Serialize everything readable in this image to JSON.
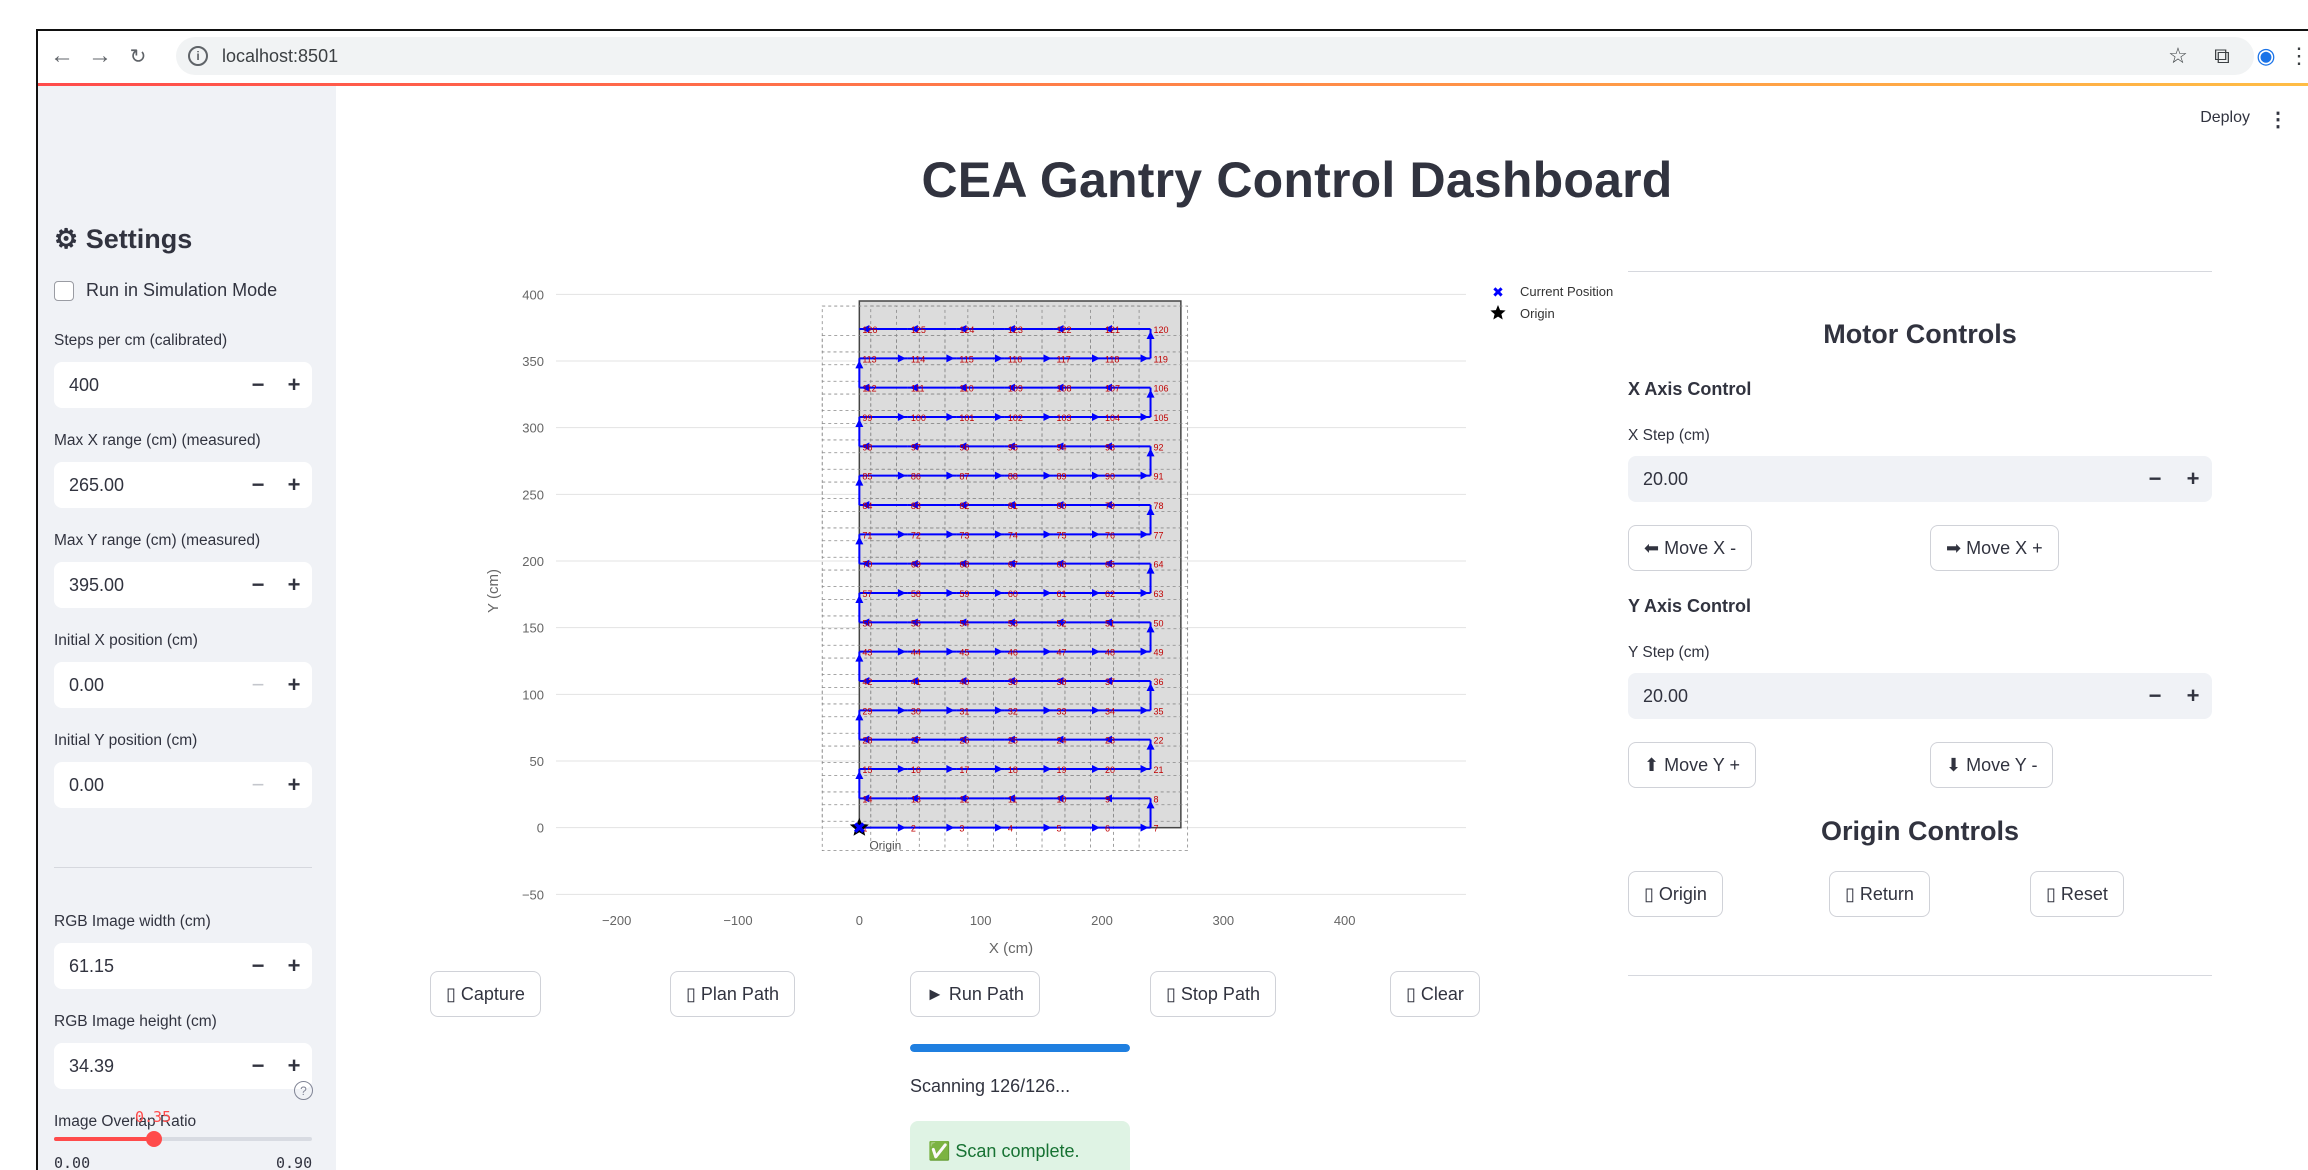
{
  "browser": {
    "url": "localhost:8501",
    "back_icon": "arrow-back-icon",
    "forward_icon": "arrow-forward-icon",
    "reload_icon": "reload-icon"
  },
  "header": {
    "deploy_label": "Deploy"
  },
  "sidebar": {
    "title": "⚙ Settings",
    "simulation_label": "Run in Simulation Mode",
    "simulation_checked": false,
    "fields": [
      {
        "label": "Steps per cm (calibrated)",
        "value": "400"
      },
      {
        "label": "Max X range (cm) (measured)",
        "value": "265.00"
      },
      {
        "label": "Max Y range (cm) (measured)",
        "value": "395.00"
      },
      {
        "label": "Initial X position (cm)",
        "value": "0.00"
      },
      {
        "label": "Initial Y position (cm)",
        "value": "0.00"
      },
      {
        "label": "RGB Image width (cm)",
        "value": "61.15"
      },
      {
        "label": "RGB Image height (cm)",
        "value": "34.39"
      }
    ],
    "overlap": {
      "label": "Image Overlap Ratio",
      "value": "0.35",
      "min": "0.00",
      "max": "0.90",
      "fraction": 0.389
    }
  },
  "main": {
    "title": "CEA Gantry Control Dashboard",
    "buttons": {
      "capture": "▯ Capture",
      "plan": "▯ Plan Path",
      "run": "► Run Path",
      "stop": "▯ Stop Path",
      "clear": "▯ Clear"
    },
    "progress_fraction": 1.0,
    "status": "Scanning 126/126...",
    "success": "✅ Scan complete."
  },
  "chart_data": {
    "type": "scatter",
    "xlabel": "X (cm)",
    "ylabel": "Y (cm)",
    "xlim": [
      -250,
      500
    ],
    "ylim": [
      -55,
      410
    ],
    "xticks": [
      -200,
      -100,
      0,
      100,
      200,
      300,
      400
    ],
    "xtick_labels": [
      "−200",
      "−100",
      "0",
      "100",
      "200",
      "300",
      "400"
    ],
    "yticks": [
      -50,
      0,
      50,
      100,
      150,
      200,
      250,
      300,
      350,
      400
    ],
    "ytick_labels": [
      "−50",
      "0",
      "50",
      "100",
      "150",
      "200",
      "250",
      "300",
      "350",
      "400"
    ],
    "grid": true,
    "legend": {
      "placement": "top-right",
      "entries": [
        {
          "name": "Current Position",
          "marker": "x",
          "color": "#0000ff"
        },
        {
          "name": "Origin",
          "marker": "star",
          "color": "#000000"
        }
      ]
    },
    "origin_label": "Origin",
    "origin": [
      0,
      0
    ],
    "current_position": [
      0,
      0
    ],
    "work_area": {
      "x": [
        0,
        265
      ],
      "y": [
        0,
        395
      ]
    },
    "scan_grid": {
      "columns_x": [
        0,
        40,
        80,
        120,
        160,
        200,
        240
      ],
      "rows_y": [
        0,
        22,
        44,
        66,
        88,
        110,
        132,
        154,
        176,
        198,
        220,
        242,
        264,
        286,
        308,
        330,
        352,
        374
      ],
      "image_width": 61.15,
      "image_height": 34.39
    },
    "path_colors": {
      "path": "#0000ff",
      "labels": "#c00000",
      "tiles": "#555555"
    }
  },
  "motor": {
    "title": "Motor Controls",
    "x_title": "X Axis Control",
    "x_step_label": "X Step (cm)",
    "x_step_value": "20.00",
    "move_x_minus": "⬅ Move X -",
    "move_x_plus": "➡ Move X +",
    "y_title": "Y Axis Control",
    "y_step_label": "Y Step (cm)",
    "y_step_value": "20.00",
    "move_y_plus": "⬆ Move Y +",
    "move_y_minus": "⬇ Move Y -"
  },
  "origin_controls": {
    "title": "Origin Controls",
    "origin": "▯ Origin",
    "return": "▯ Return",
    "reset": "▯ Reset"
  }
}
